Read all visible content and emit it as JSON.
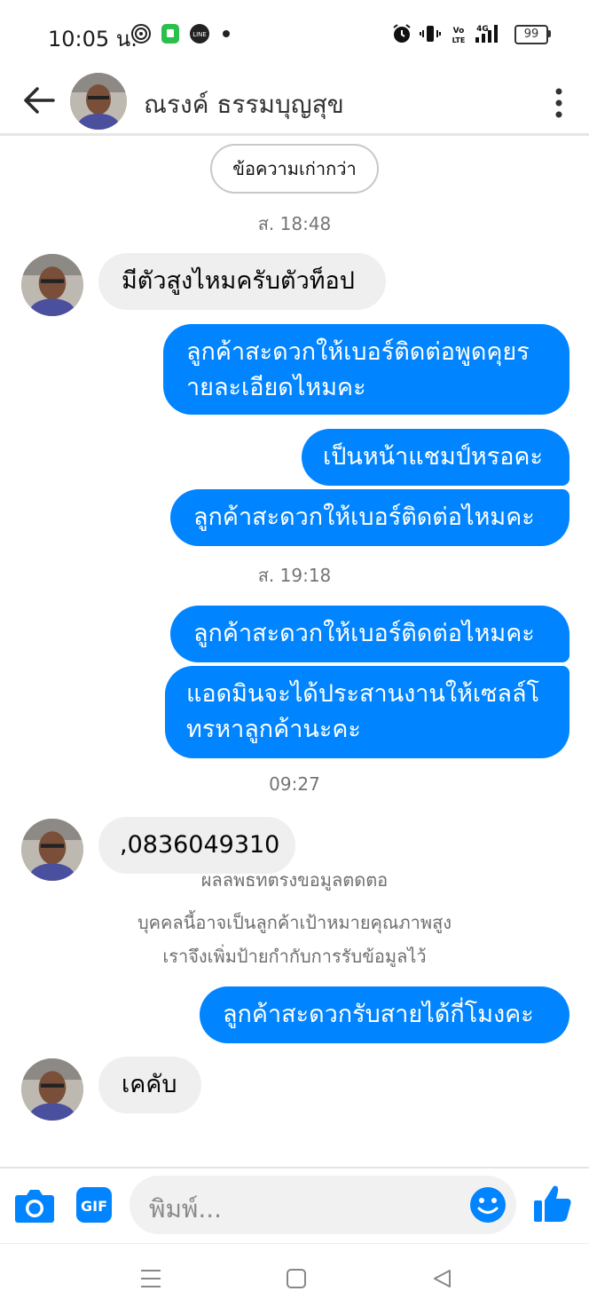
{
  "status_bar": {
    "time": "10:05 น.",
    "battery": "99"
  },
  "header": {
    "contact_name": "ณรงค์ ธรรมบุญสุข"
  },
  "chat": {
    "older_messages_button": "ข้อความเก่ากว่า",
    "timestamps": [
      "ส. 18:48",
      "ส. 19:18",
      "09:27"
    ],
    "messages": [
      {
        "sender": "contact",
        "text": "มีตัวสูงไหมครับตัวท็อป"
      },
      {
        "sender": "me",
        "lines": [
          "ลูกค้าสะดวกให้เบอร์ติดต่อพูดคุยร",
          "ายละเอียดไหมคะ"
        ]
      },
      {
        "sender": "me",
        "text": "เป็นหน้าแชมป์หรอคะ"
      },
      {
        "sender": "me",
        "text": "ลูกค้าสะดวกให้เบอร์ติดต่อไหมคะ"
      },
      {
        "sender": "me",
        "text": "ลูกค้าสะดวกให้เบอร์ติดต่อไหมคะ"
      },
      {
        "sender": "me",
        "lines": [
          "แอดมินจะได้ประสานงานให้เซลล์โ",
          "ทรหาลูกค้านะคะ"
        ]
      },
      {
        "sender": "contact",
        "text": ",0836049310"
      },
      {
        "sender": "me",
        "text": "ลูกค้าสะดวกรับสายได้กี่โมงคะ"
      },
      {
        "sender": "contact",
        "text": "เคคับ"
      }
    ],
    "system_notice": {
      "partial_line": "ผลลัพธ์ที่ตรงข้อมูลติดต่อ",
      "lines": [
        "บุคคลนี้อาจเป็นลูกค้าเป้าหมายคุณภาพสูง",
        "เราจึงเพิ่มป้ายกำกับการรับข้อมูลไว้"
      ]
    }
  },
  "composer": {
    "placeholder": "พิมพ์...",
    "gif_label": "GIF"
  },
  "colors": {
    "accent": "#0084ff",
    "incoming_bubble": "#efefef"
  },
  "icons": [
    "back-arrow-icon",
    "more-vert-icon",
    "camera-icon",
    "gif-icon",
    "emoji-icon",
    "thumbs-up-icon",
    "menu-icon",
    "home-icon",
    "back-triangle-icon"
  ]
}
